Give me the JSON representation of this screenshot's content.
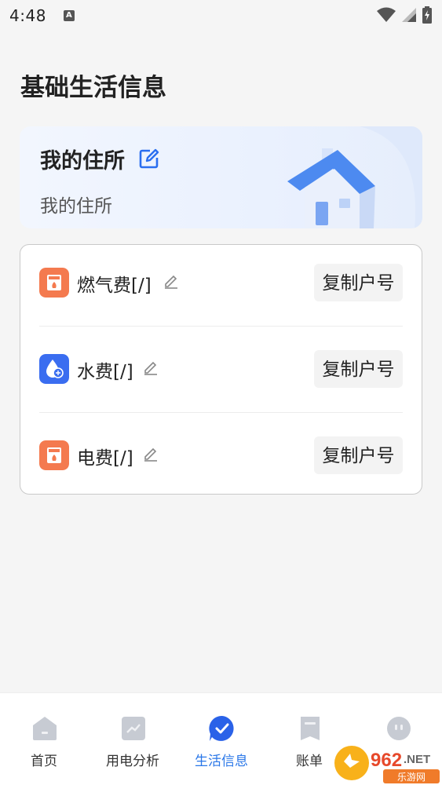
{
  "status_bar": {
    "time": "4:48",
    "a_badge": "A"
  },
  "page_title": "基础生活信息",
  "residence": {
    "title": "我的住所",
    "subtitle": "我的住所"
  },
  "bills": [
    {
      "label": "燃气费[/]",
      "copy_label": "复制户号",
      "icon": "gas-icon",
      "color": "#f47a4f"
    },
    {
      "label": "水费[/]",
      "copy_label": "复制户号",
      "icon": "water-icon",
      "color": "#3a6df0"
    },
    {
      "label": "电费[/]",
      "copy_label": "复制户号",
      "icon": "electricity-icon",
      "color": "#f47a4f"
    }
  ],
  "bottom_nav": {
    "items": [
      {
        "label": "首页",
        "icon": "home-icon",
        "active": false
      },
      {
        "label": "用电分析",
        "icon": "trend-chart-icon",
        "active": false
      },
      {
        "label": "生活信息",
        "icon": "check-bubble-icon",
        "active": true
      },
      {
        "label": "账单",
        "icon": "bill-icon",
        "active": false
      },
      {
        "label": "",
        "icon": "profile-icon",
        "active": false
      }
    ]
  },
  "watermark": {
    "brand": "962",
    "domain": ".NET",
    "site": "乐游网"
  },
  "colors": {
    "accent": "#2a77e8",
    "orange": "#f47a4f",
    "blue": "#3a6df0"
  }
}
